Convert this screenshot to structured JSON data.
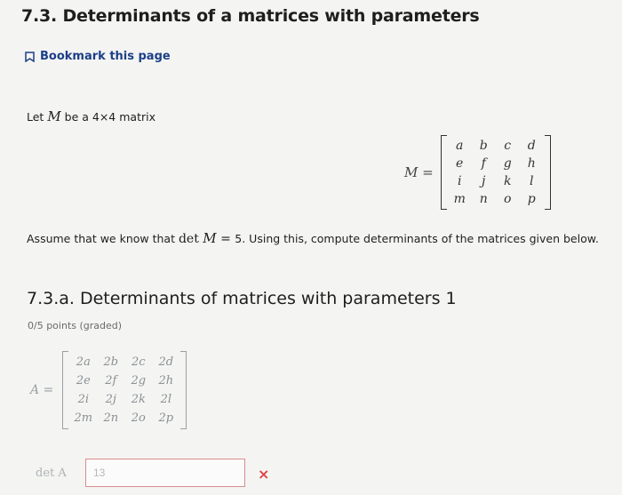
{
  "page": {
    "title": "7.3. Determinants of a matrices with parameters",
    "bookmark_label": "Bookmark this page"
  },
  "intro": {
    "prefix": "Let ",
    "var": "M",
    "suffix": " be a 4×4 matrix"
  },
  "matrix_m": {
    "label_var": "M",
    "label_eq": " =",
    "cells": [
      "a",
      "b",
      "c",
      "d",
      "e",
      "f",
      "g",
      "h",
      "i",
      "j",
      "k",
      "l",
      "m",
      "n",
      "o",
      "p"
    ]
  },
  "assume": {
    "prefix": "Assume that we know that ",
    "det": "det ",
    "var": "M",
    "eq": " = ",
    "value": "5",
    "suffix": ". Using this, compute determinants of the matrices given below."
  },
  "problem": {
    "title": "7.3.a. Determinants of matrices with parameters 1",
    "points": "0/5 points (graded)",
    "matrix_label_var": "A",
    "matrix_label_eq": " =",
    "cells": [
      "2a",
      "2b",
      "2c",
      "2d",
      "2e",
      "2f",
      "2g",
      "2h",
      "2i",
      "2j",
      "2k",
      "2l",
      "2m",
      "2n",
      "2o",
      "2p"
    ],
    "answer_label": "det A",
    "answer_value": "13",
    "status_icon": "×",
    "status_color": "#dd4444"
  }
}
